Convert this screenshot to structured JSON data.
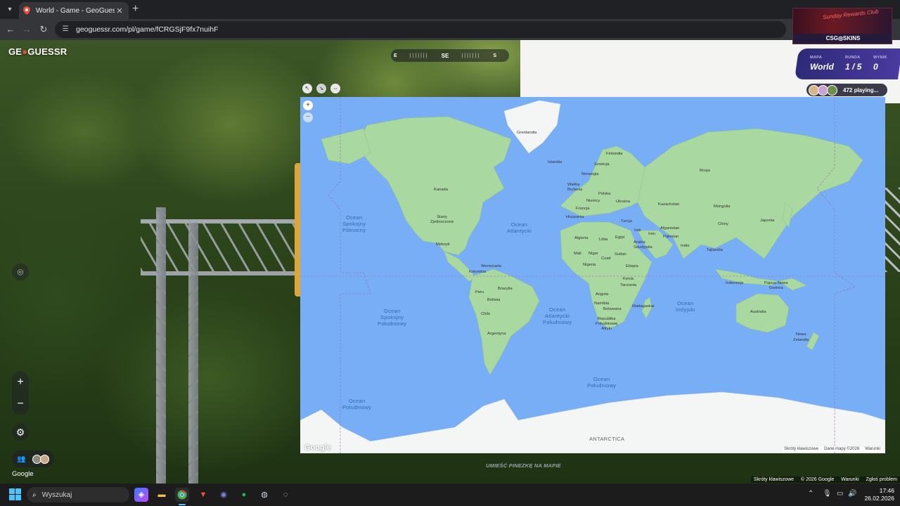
{
  "browser": {
    "tab_title": "World - Game - GeoGuessr",
    "url": "geoguessr.com/pl/game/fCRGSjF9fx7nuihF"
  },
  "ad": {
    "title": "Sunday Rewards Club",
    "brand": "CSG◎SKINS"
  },
  "game": {
    "logo_left": "GE",
    "logo_right": "GUESSR",
    "compass": {
      "left": "E",
      "center": "SE",
      "right": "S"
    },
    "stats": {
      "map_label": "MAPA",
      "map_value": "World",
      "round_label": "RUNDA",
      "round_value": "1 / 5",
      "score_label": "WYNIK",
      "score_value": "0"
    },
    "players_text": "472 playing...",
    "place_pin_text": "UMIEŚĆ PINEZKĘ NA MAPIE",
    "google_text": "Google",
    "sv_footer": [
      "Skróty klawiszowe",
      "© 2026 Google",
      "Warunki",
      "Zgłoś problem"
    ]
  },
  "map": {
    "zoom_in": "+",
    "zoom_out": "−",
    "google_logo": "Google",
    "footer": [
      "Skróty klawiszowe",
      "Dane mapy ©2026",
      "Warunki"
    ],
    "oceans": {
      "north_pacific": "Ocean\nSpokojny\nPółnocny",
      "north_atlantic": "Ocean\nAtlantycki",
      "south_pacific": "Ocean\nSpokojny\nPołudniowy",
      "south_atlantic": "Ocean\nAtlantycki\nPołudniowy",
      "indian": "Ocean\nIndyjski",
      "southern_center": "Ocean\nPołudniowy",
      "southern_left": "Ocean\nPołudniowy",
      "antarctica": "ANTARCTICA"
    },
    "places": {
      "greenland": "Grenlandia",
      "iceland": "Islandia",
      "finland": "Finlandia",
      "sweden": "Szwecja",
      "norway": "Norwegia",
      "uk": "Wielka\nBrytania",
      "poland": "Polska",
      "germany": "Niemcy",
      "ukraine": "Ukraina",
      "france": "Francja",
      "spain": "Hiszpania",
      "russia": "Rosja",
      "kazakhstan": "Kazachstan",
      "mongolia": "Mongolia",
      "china": "Chiny",
      "japan": "Japonia",
      "turkey": "Turcja",
      "iraq": "Irak",
      "iran": "Iran",
      "afghanistan": "Afganistan",
      "pakistan": "Pakistan",
      "india": "Indie",
      "thailand": "Tajlandia",
      "indonesia": "Indonezja",
      "papua": "Papua-Nowa\nGwinea",
      "australia": "Australia",
      "new_zealand": "Nowa\nZelandia",
      "canada": "Kanada",
      "usa": "Stany\nZjednoczone",
      "mexico": "Meksyk",
      "venezuela": "Wenezuela",
      "colombia": "Kolumbia",
      "peru": "Peru",
      "brazil": "Brazylia",
      "bolivia": "Boliwia",
      "chile": "Chile",
      "argentina": "Argentyna",
      "algeria": "Algieria",
      "libya": "Libia",
      "egypt": "Egipt",
      "saudi": "Arabia\nSaudyjska",
      "mali": "Mali",
      "niger": "Niger",
      "chad": "Czad",
      "sudan": "Sudan",
      "nigeria": "Nigeria",
      "ethiopia": "Etiopia",
      "kenya": "Kenia",
      "tanzania": "Tanzania",
      "angola": "Angola",
      "namibia": "Namibia",
      "botswana": "Botswana",
      "madagascar": "Madagaskar",
      "south_africa": "Republika\nPołudniowej\nAfryki"
    }
  },
  "taskbar": {
    "search_placeholder": "Wyszukaj",
    "time": "17:46",
    "date": "26.02.2026"
  },
  "colors": {
    "ocean": "#78aef6",
    "land": "#a9d8a0",
    "ice": "#f4f5f5",
    "accent": "#4a3aa0"
  }
}
